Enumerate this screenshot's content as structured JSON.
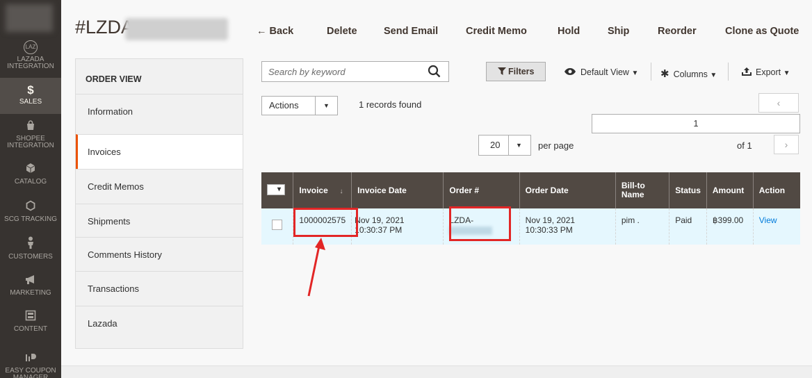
{
  "nav": {
    "items": [
      {
        "label": "LAZADA INTEGRATION",
        "icon": "lazada-icon"
      },
      {
        "label": "SALES",
        "icon": "dollar-icon",
        "active": true
      },
      {
        "label": "SHOPEE INTEGRATION",
        "icon": "shopping-bag-icon"
      },
      {
        "label": "CATALOG",
        "icon": "cube-icon"
      },
      {
        "label": "SCG TRACKING",
        "icon": "hexagon-icon"
      },
      {
        "label": "CUSTOMERS",
        "icon": "person-icon"
      },
      {
        "label": "MARKETING",
        "icon": "megaphone-icon"
      },
      {
        "label": "CONTENT",
        "icon": "layout-icon"
      },
      {
        "label": "EASY COUPON MANAGER",
        "icon": "coupon-icon"
      }
    ],
    "lazada_glyph": "LAZ"
  },
  "header": {
    "title": "#LZDA-",
    "actions": {
      "back": "← Back",
      "delete": "Delete",
      "send_email": "Send Email",
      "credit_memo": "Credit Memo",
      "hold": "Hold",
      "ship": "Ship",
      "reorder": "Reorder",
      "clone_as_quote": "Clone as Quote"
    }
  },
  "sidebar": {
    "title": "ORDER VIEW",
    "items": [
      {
        "label": "Information"
      },
      {
        "label": "Invoices",
        "active": true
      },
      {
        "label": "Credit Memos"
      },
      {
        "label": "Shipments"
      },
      {
        "label": "Comments History"
      },
      {
        "label": "Transactions"
      },
      {
        "label": "Lazada"
      }
    ]
  },
  "toolbar": {
    "search_placeholder": "Search by keyword",
    "filters": "Filters",
    "default_view": "Default View",
    "columns": "Columns",
    "export": "Export",
    "actions": "Actions",
    "records_found": "1 records found",
    "current_page": "1",
    "per_page_value": "20",
    "per_page_label": "per page",
    "of_pages": "of 1",
    "prev": "‹",
    "next": "›"
  },
  "grid": {
    "columns": [
      "Invoice",
      "Invoice Date",
      "Order #",
      "Order Date",
      "Bill-to Name",
      "Status",
      "Amount",
      "Action"
    ],
    "sort_indicator": "↓",
    "rows": [
      {
        "invoice": "1000002575",
        "invoice_date": "Nov 19, 2021 10:30:37 PM",
        "order": "LZDA-",
        "order_date": "Nov 19, 2021 10:30:33 PM",
        "bill_to": "pim .",
        "status": "Paid",
        "amount": "฿399.00",
        "action": "View"
      }
    ]
  },
  "colors": {
    "accent": "#eb5202",
    "grid_header": "#514943",
    "row_highlight": "#e5f7fe",
    "annotation": "#e22626",
    "link": "#007bdb"
  }
}
